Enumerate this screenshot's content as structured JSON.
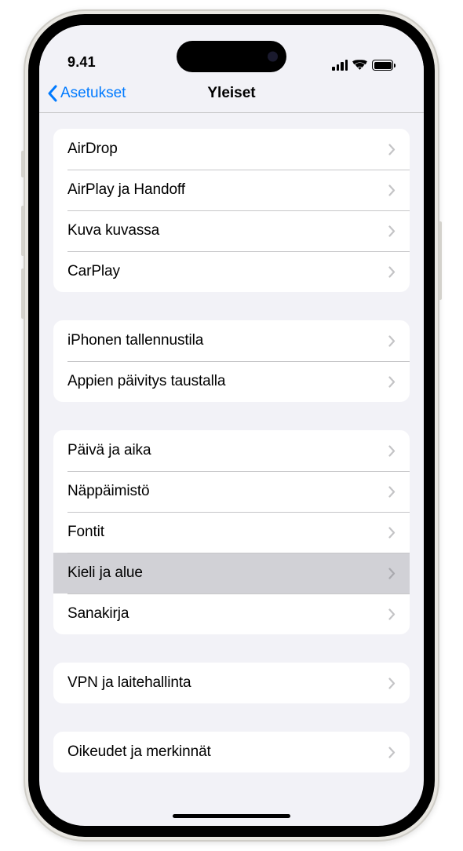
{
  "status_bar": {
    "time": "9.41"
  },
  "nav": {
    "back_label": "Asetukset",
    "title": "Yleiset"
  },
  "groups": [
    {
      "items": [
        {
          "label": "AirDrop",
          "highlighted": false
        },
        {
          "label": "AirPlay ja Handoff",
          "highlighted": false
        },
        {
          "label": "Kuva kuvassa",
          "highlighted": false
        },
        {
          "label": "CarPlay",
          "highlighted": false
        }
      ]
    },
    {
      "items": [
        {
          "label": "iPhonen tallennustila",
          "highlighted": false
        },
        {
          "label": "Appien päivitys taustalla",
          "highlighted": false
        }
      ]
    },
    {
      "items": [
        {
          "label": "Päivä ja aika",
          "highlighted": false
        },
        {
          "label": "Näppäimistö",
          "highlighted": false
        },
        {
          "label": "Fontit",
          "highlighted": false
        },
        {
          "label": "Kieli ja alue",
          "highlighted": true
        },
        {
          "label": "Sanakirja",
          "highlighted": false
        }
      ]
    },
    {
      "items": [
        {
          "label": "VPN ja laitehallinta",
          "highlighted": false
        }
      ]
    },
    {
      "items": [
        {
          "label": "Oikeudet ja merkinnät",
          "highlighted": false
        }
      ]
    }
  ]
}
